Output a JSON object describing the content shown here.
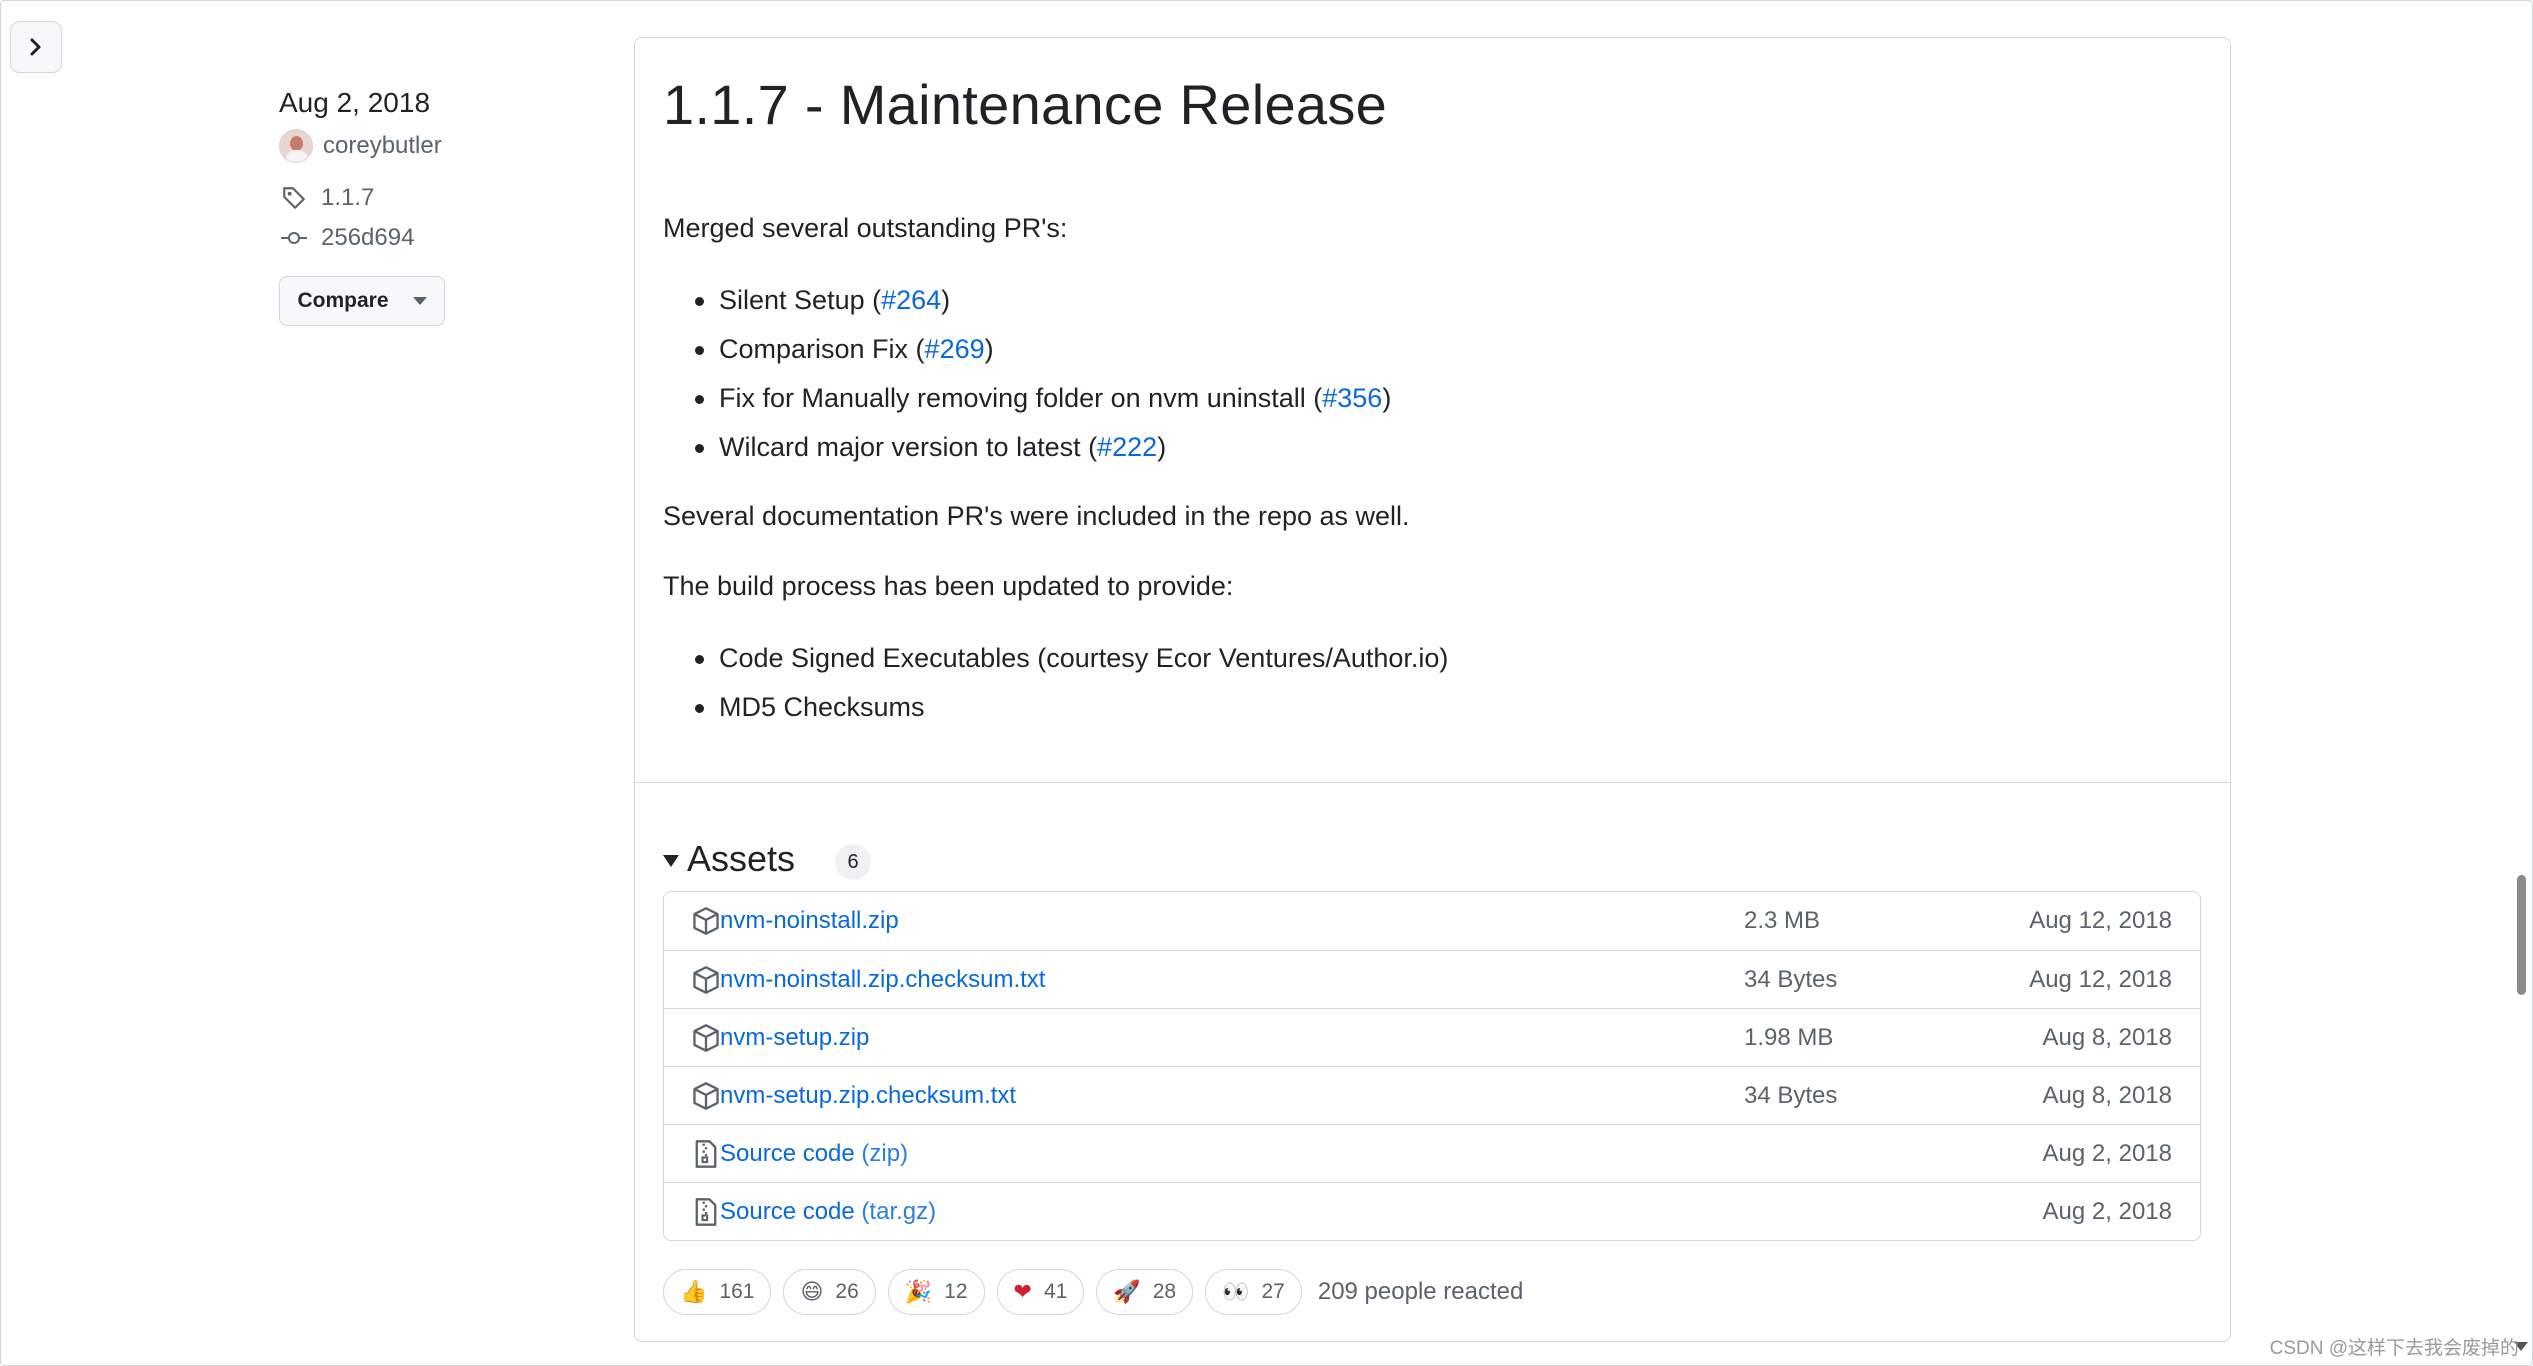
{
  "sidebar": {
    "date": "Aug 2, 2018",
    "author": "coreybutler",
    "tag": "1.1.7",
    "commit": "256d694",
    "compare_label": "Compare"
  },
  "release": {
    "title": "1.1.7 - Maintenance Release",
    "intro": "Merged several outstanding PR's:",
    "prs": [
      {
        "text": "Silent Setup (",
        "link": "#264",
        "close": ")"
      },
      {
        "text": "Comparison Fix (",
        "link": "#269",
        "close": ")"
      },
      {
        "text": "Fix for Manually removing folder on nvm uninstall (",
        "link": "#356",
        "close": ")"
      },
      {
        "text": "Wilcard major version to latest (",
        "link": "#222",
        "close": ")"
      }
    ],
    "docs_note": "Several documentation PR's were included in the repo as well.",
    "build_intro": "The build process has been updated to provide:",
    "build_items": [
      "Code Signed Executables (courtesy Ecor Ventures/Author.io)",
      "MD5 Checksums"
    ]
  },
  "assets": {
    "title": "Assets",
    "count": "6",
    "rows": [
      {
        "name": "nvm-noinstall.zip",
        "suffix": "",
        "size": "2.3 MB",
        "date": "Aug 12, 2018",
        "icon": "package-icon"
      },
      {
        "name": "nvm-noinstall.zip.checksum.txt",
        "suffix": "",
        "size": "34 Bytes",
        "date": "Aug 12, 2018",
        "icon": "package-icon"
      },
      {
        "name": "nvm-setup.zip",
        "suffix": "",
        "size": "1.98 MB",
        "date": "Aug 8, 2018",
        "icon": "package-icon"
      },
      {
        "name": "nvm-setup.zip.checksum.txt",
        "suffix": "",
        "size": "34 Bytes",
        "date": "Aug 8, 2018",
        "icon": "package-icon"
      },
      {
        "name": "Source code",
        "suffix": " (zip)",
        "size": "",
        "date": "Aug 2, 2018",
        "icon": "file-zip-icon"
      },
      {
        "name": "Source code",
        "suffix": " (tar.gz)",
        "size": "",
        "date": "Aug 2, 2018",
        "icon": "file-zip-icon"
      }
    ]
  },
  "reactions": {
    "items": [
      {
        "emoji": "👍",
        "count": "161",
        "name": "thumbs-up"
      },
      {
        "emoji": "😄",
        "count": "26",
        "name": "laugh"
      },
      {
        "emoji": "🎉",
        "count": "12",
        "name": "hooray"
      },
      {
        "emoji": "❤",
        "count": "41",
        "name": "heart"
      },
      {
        "emoji": "🚀",
        "count": "28",
        "name": "rocket"
      },
      {
        "emoji": "👀",
        "count": "27",
        "name": "eyes"
      }
    ],
    "summary": "209 people reacted"
  },
  "watermark": "CSDN @这样下去我会废掉的",
  "colors": {
    "link": "#0969da",
    "text": "#1f2328",
    "muted": "#59636e",
    "border": "#d0d7de"
  }
}
